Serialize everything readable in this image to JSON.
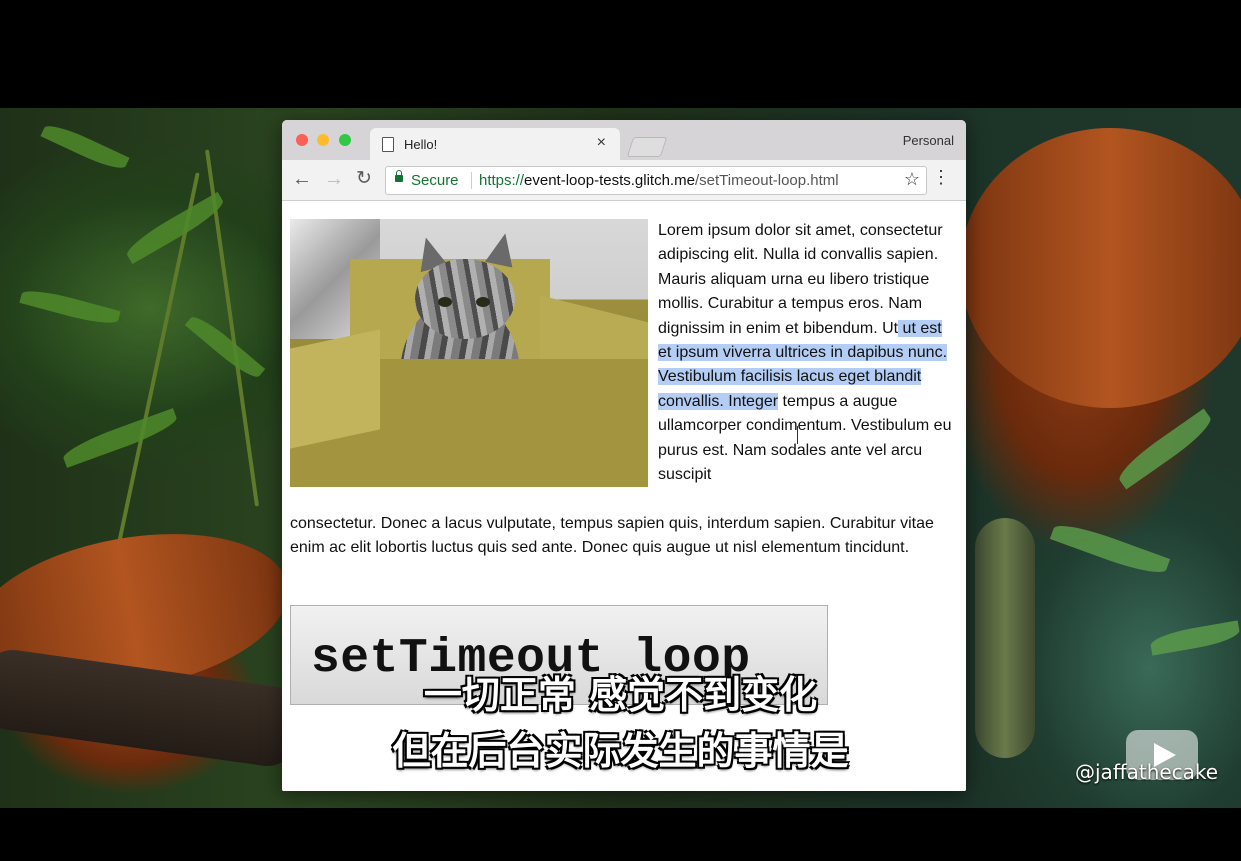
{
  "browser": {
    "tab_title": "Hello!",
    "tab_close": "×",
    "profile_label": "Personal",
    "back_icon": "←",
    "forward_icon": "→",
    "reload_icon": "↻",
    "secure_label": "Secure",
    "url_scheme": "https://",
    "url_host": "event-loop-tests.glitch.me",
    "url_path": "/setTimeout-loop.html",
    "star_icon": "☆",
    "menu_icon": "⋮"
  },
  "page": {
    "image_alt": "kitten in a cardboard box",
    "para_right_before": "Lorem ipsum dolor sit amet, consectetur adipiscing elit. Nulla id convallis sapien. Mauris aliquam urna eu libero tristique mollis. Curabitur a tempus eros. Nam dignissim in enim et bibendum. Ut",
    "para_right_highlight": " ut est et ipsum viverra ultrices in dapibus nunc. Vestibulum facilisis lacus eget blandit convallis. Integer",
    "para_right_after": " tempus a augue ullamcorper condimentum. Vestibulum eu purus est. Nam sodales ante vel arcu suscipit",
    "para_full": "consectetur. Donec a lacus vulputate, tempus sapien quis, interdum sapien. Curabitur vitae enim ac elit lobortis luctus quis sed ante. Donec quis augue ut nisl elementum tincidunt.",
    "settimeout_label": "setTimeout loop"
  },
  "subtitles": {
    "line1": "一切正常 感觉不到变化",
    "line2": "但在后台实际发生的事情是"
  },
  "watermark": {
    "handle": "@jaffathecake"
  },
  "colors": {
    "secure_green": "#137333",
    "selection": "#b4cdf5"
  }
}
